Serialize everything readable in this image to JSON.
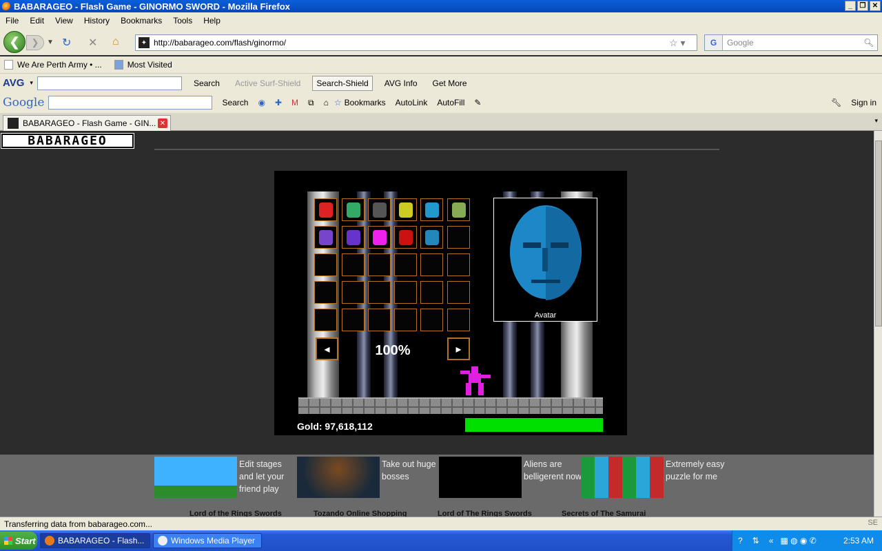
{
  "window": {
    "title": "BABARAGEO - Flash Game - GINORMO SWORD - Mozilla Firefox"
  },
  "menu": [
    "File",
    "Edit",
    "View",
    "History",
    "Bookmarks",
    "Tools",
    "Help"
  ],
  "nav": {
    "url": "http://babarageo.com/flash/ginormo/",
    "search_placeholder": "Google",
    "search_engine": "G"
  },
  "bookmarks": [
    "We Are Perth Army • ...",
    "Most Visited"
  ],
  "avg_toolbar": {
    "logo": "AVG",
    "items": [
      "Search",
      "Active Surf-Shield",
      "Search-Shield",
      "AVG Info",
      "Get More"
    ]
  },
  "google_toolbar": {
    "logo": "Google",
    "items": [
      "Search",
      "Bookmarks",
      "AutoLink",
      "AutoFill",
      "Sign in"
    ]
  },
  "tab": {
    "title": "BABARAGEO - Flash Game - GIN..."
  },
  "site": {
    "logo": "BABARAGEO"
  },
  "game": {
    "avatar_label": "Avatar",
    "zoom": "100%",
    "gold": "Gold: 97,618,112",
    "prev_arrow": "◂",
    "next_arrow": "▸",
    "health_fill": 1.0,
    "health_color": "#00e000"
  },
  "ads": [
    {
      "text": "Edit stages and let your friend play",
      "title": "Lord of the Rings Swords"
    },
    {
      "text": "Take out huge bosses",
      "title": "Tozando Online Shopping"
    },
    {
      "text": "Aliens are belligerent now",
      "title": "Lord of The Rings Swords"
    },
    {
      "text": "Extremely easy puzzle for me",
      "title": "Secrets of The Samurai"
    }
  ],
  "status": {
    "text": "Transferring data from babarageo.com...",
    "badge": "SE"
  },
  "taskbar": {
    "start": "Start",
    "tasks": [
      "BABARAGEO - Flash...",
      "Windows Media Player"
    ],
    "time": "2:53 AM"
  }
}
